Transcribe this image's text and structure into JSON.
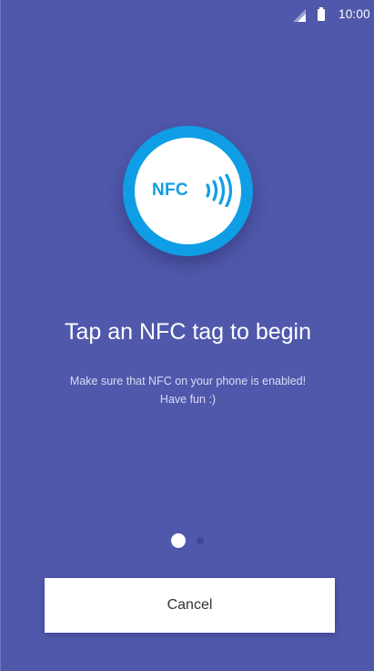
{
  "status_bar": {
    "time": "10:00",
    "signal_icon": "cellular-signal-icon",
    "battery_icon": "battery-icon"
  },
  "nfc_badge": {
    "label": "NFC",
    "icon": "nfc-waves-icon",
    "ring_color": "#0f9ee5"
  },
  "main": {
    "title": "Tap an NFC tag to begin",
    "subtitle_line1": "Make sure that NFC on your phone is enabled!",
    "subtitle_line2": "Have fun :)"
  },
  "pager": {
    "page_count": 2,
    "active_page": 1
  },
  "actions": {
    "cancel_label": "Cancel"
  },
  "colors": {
    "background": "#5058ab",
    "accent": "#0f9ee5"
  }
}
